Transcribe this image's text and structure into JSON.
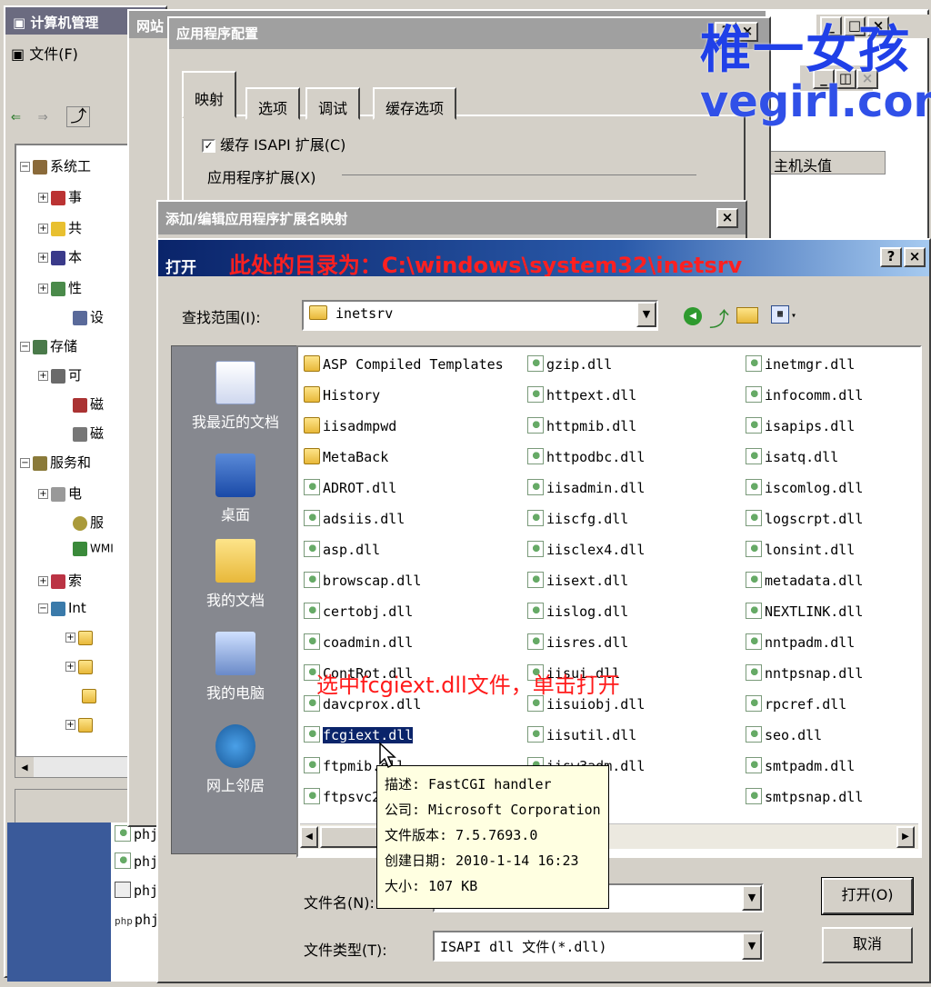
{
  "mmc": {
    "title": "计算机管理",
    "menu_file": "文件(F)",
    "tree": [
      {
        "label": "系统工",
        "expander": "−"
      },
      {
        "label": "事",
        "expander": "+"
      },
      {
        "label": "共",
        "expander": "+"
      },
      {
        "label": "本",
        "expander": "+"
      },
      {
        "label": "性",
        "expander": "+"
      },
      {
        "label": "设",
        "expander": ""
      },
      {
        "label": "存储",
        "expander": "−"
      },
      {
        "label": "可",
        "expander": "+"
      },
      {
        "label": "磁",
        "expander": ""
      },
      {
        "label": "磁",
        "expander": ""
      },
      {
        "label": "服务和",
        "expander": "−"
      },
      {
        "label": "电",
        "expander": "+"
      },
      {
        "label": "服",
        "expander": ""
      },
      {
        "label": "WMI",
        "expander": ""
      },
      {
        "label": "索",
        "expander": "+"
      },
      {
        "label": "Int",
        "expander": "−"
      },
      {
        "label": "",
        "expander": "+"
      },
      {
        "label": "",
        "expander": "+"
      },
      {
        "label": "",
        "expander": ""
      },
      {
        "label": "",
        "expander": "+"
      }
    ],
    "lower_files": [
      "phj",
      "phj",
      "phj",
      "phj"
    ],
    "lower_php_tag": "php"
  },
  "site_window": {
    "title": "网站"
  },
  "right_window": {
    "header": "主机头值"
  },
  "app_config": {
    "title": "应用程序配置",
    "tabs": [
      "映射",
      "选项",
      "调试",
      "缓存选项"
    ],
    "cache_checkbox": "缓存 ISAPI 扩展(C)",
    "group_label": "应用程序扩展(X)"
  },
  "add_edit": {
    "title": "添加/编辑应用程序扩展名映射"
  },
  "open_dialog": {
    "title": "打开",
    "annotation_path": "此处的目录为：C:\\windows\\system32\\inetsrv",
    "look_in_label": "查找范围(I):",
    "look_in_value": "inetsrv",
    "places": [
      "我最近的文档",
      "桌面",
      "我的文档",
      "我的电脑",
      "网上邻居"
    ],
    "files_col1": [
      {
        "name": "ASP Compiled Templates",
        "type": "folder"
      },
      {
        "name": "History",
        "type": "folder"
      },
      {
        "name": "iisadmpwd",
        "type": "folder"
      },
      {
        "name": "MetaBack",
        "type": "folder"
      },
      {
        "name": "ADROT.dll",
        "type": "dll"
      },
      {
        "name": "adsiis.dll",
        "type": "dll"
      },
      {
        "name": "asp.dll",
        "type": "dll"
      },
      {
        "name": "browscap.dll",
        "type": "dll"
      },
      {
        "name": "certobj.dll",
        "type": "dll"
      },
      {
        "name": "coadmin.dll",
        "type": "dll"
      },
      {
        "name": "ContRot.dll",
        "type": "dll"
      },
      {
        "name": "davcprox.dll",
        "type": "dll"
      },
      {
        "name": "fcgiext.dll",
        "type": "dll"
      },
      {
        "name": "ftpmib.dll",
        "type": "dll"
      },
      {
        "name": "ftpsvc2.dll",
        "type": "dll"
      }
    ],
    "files_col2": [
      "gzip.dll",
      "httpext.dll",
      "httpmib.dll",
      "httpodbc.dll",
      "iisadmin.dll",
      "iiscfg.dll",
      "iisclex4.dll",
      "iisext.dll",
      "iislog.dll",
      "iisres.dll",
      "iisui.dll",
      "iisuiobj.dll",
      "iisutil.dll",
      "iisw3adm.dll",
      "ll"
    ],
    "files_col3": [
      "inetmgr.dll",
      "infocomm.dll",
      "isapips.dll",
      "isatq.dll",
      "iscomlog.dll",
      "logscrpt.dll",
      "lonsint.dll",
      "metadata.dll",
      "NEXTLINK.dll",
      "nntpadm.dll",
      "nntpsnap.dll",
      "rpcref.dll",
      "seo.dll",
      "smtpadm.dll",
      "smtpsnap.dll"
    ],
    "annotation_select": "选中fcgiext.dll文件，单击打开",
    "tooltip": [
      "描述: FastCGI handler",
      "公司: Microsoft Corporation",
      "文件版本: 7.5.7693.0",
      "创建日期: 2010-1-14 16:23",
      "大小: 107 KB"
    ],
    "filename_label": "文件名(N):",
    "filetype_label": "文件类型(T):",
    "filetype_value": "ISAPI dll 文件(*.dll)",
    "open_button": "打开(O)",
    "cancel_button": "取消",
    "help_button": "?",
    "close_button": "×"
  },
  "watermark": {
    "line1": "椎一女孩",
    "line2": "vegirl.com"
  }
}
